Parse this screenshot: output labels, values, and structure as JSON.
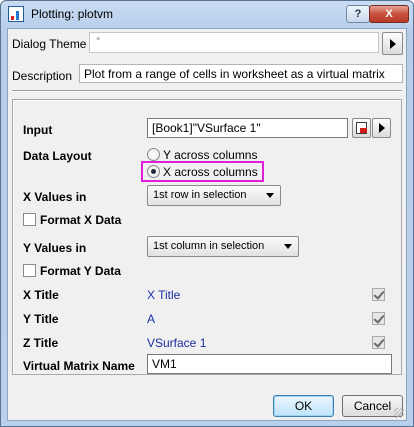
{
  "window": {
    "title": "Plotting: plotvm",
    "help_label": "?",
    "close_label": "X"
  },
  "header": {
    "theme_label": "Dialog Theme",
    "theme_value": "*",
    "description_label": "Description",
    "description_value": "Plot from a range of cells in worksheet as a virtual matrix"
  },
  "form": {
    "input_label": "Input",
    "input_value": "[Book1]\"VSurface 1\"",
    "data_layout_label": "Data Layout",
    "layout_options": [
      "Y across columns",
      "X across columns"
    ],
    "layout_selected": "X across columns",
    "x_values_label": "X Values in",
    "x_values_selected": "1st row in selection",
    "format_x_label": "Format X Data",
    "format_x_checked": false,
    "y_values_label": "Y Values in",
    "y_values_selected": "1st column in selection",
    "format_y_label": "Format Y Data",
    "format_y_checked": false,
    "x_title_label": "X Title",
    "x_title_value": "X Title",
    "x_title_checked": true,
    "y_title_label": "Y Title",
    "y_title_value": "A",
    "y_title_checked": true,
    "z_title_label": "Z Title",
    "z_title_value": "VSurface 1",
    "z_title_checked": true,
    "vm_name_label": "Virtual Matrix Name",
    "vm_name_value": "VM1"
  },
  "buttons": {
    "ok": "OK",
    "cancel": "Cancel"
  },
  "colors": {
    "highlight": "#e020d8",
    "value_blue": "#1a2fa0"
  }
}
